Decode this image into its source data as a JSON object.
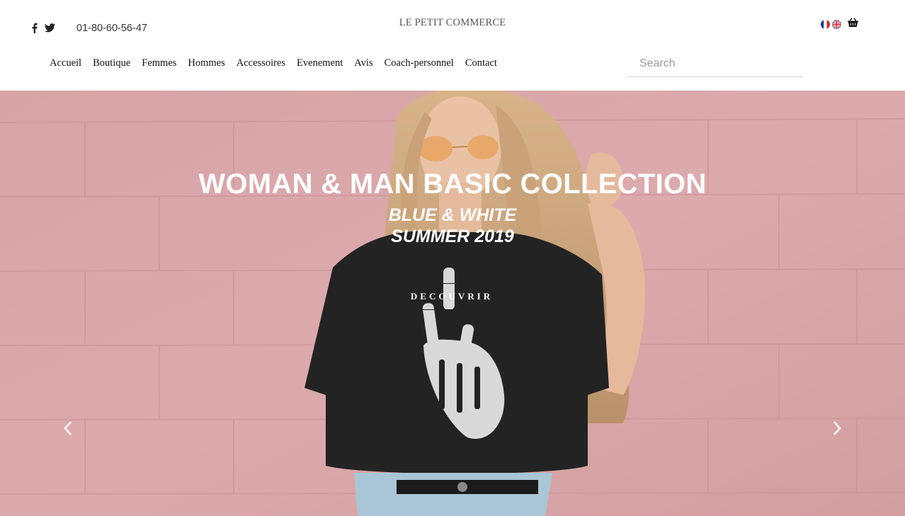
{
  "header": {
    "social": [
      "facebook-icon",
      "twitter-icon"
    ],
    "phone": "01-80-60-56-47",
    "brand": "LE PETIT COMMERCE",
    "languages": [
      "fr-flag-icon",
      "uk-flag-icon"
    ],
    "cart_icon": "basket-icon"
  },
  "nav": {
    "items": [
      "Accueil",
      "Boutique",
      "Femmes",
      "Hommes",
      "Accessoires",
      "Evenement",
      "Avis",
      "Coach-personnel",
      "Contact"
    ]
  },
  "search": {
    "placeholder": "Search"
  },
  "hero": {
    "headline": "WOMAN & MAN BASIC COLLECTION",
    "subline1": "BLUE & WHITE",
    "subline2": "SUMMER 2019",
    "cta_label": "DECOUVRIR",
    "prev_icon": "chevron-left-icon",
    "next_icon": "chevron-right-icon"
  },
  "colors": {
    "wall": "#d9a6a8",
    "shirt": "#232323",
    "hair": "#c9a27a",
    "text_white": "#ffffff"
  }
}
